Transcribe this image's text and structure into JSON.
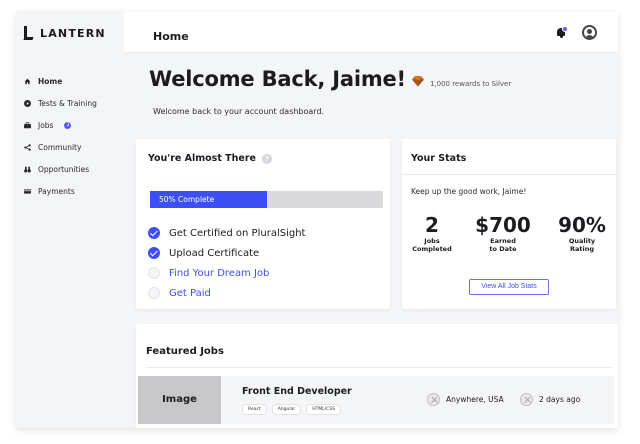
{
  "brand": {
    "name": "LANTERN"
  },
  "sidebar": {
    "items": [
      {
        "label": "Home",
        "icon": "home-icon",
        "active": true
      },
      {
        "label": "Tests & Training",
        "icon": "play-circle-icon"
      },
      {
        "label": "Jobs",
        "icon": "briefcase-icon",
        "badge": "3"
      },
      {
        "label": "Community",
        "icon": "share-icon"
      },
      {
        "label": "Opportunities",
        "icon": "binoculars-icon"
      },
      {
        "label": "Payments",
        "icon": "credit-card-icon"
      }
    ]
  },
  "header": {
    "title": "Home",
    "notification_dot_color": "#6b5cf6"
  },
  "welcome": {
    "title": "Welcome Back, Jaime!",
    "rewards": "1,000 rewards to Silver",
    "subtitle": "Welcome back to your account dashboard."
  },
  "almost": {
    "title": "You're Almost There",
    "progress_label": "50% Complete",
    "progress_value": 0.5,
    "tasks": [
      {
        "label": "Get Certified on PluralSight",
        "done": true
      },
      {
        "label": "Upload Certificate",
        "done": true
      },
      {
        "label": "Find Your Dream Job",
        "done": false
      },
      {
        "label": "Get Paid",
        "done": false
      }
    ]
  },
  "stats": {
    "title": "Your Stats",
    "subtitle": "Keep up the good work, Jaime!",
    "items": [
      {
        "value": "2",
        "label_line1": "Jobs",
        "label_line2": "Completed"
      },
      {
        "value": "$700",
        "label_line1": "Earned",
        "label_line2": "to Date"
      },
      {
        "value": "90%",
        "label_line1": "Quality",
        "label_line2": "Rating"
      }
    ],
    "button_label": "View All Job Stats"
  },
  "featured": {
    "title": "Featured Jobs",
    "jobs": [
      {
        "image_label": "Image",
        "title": "Front End Developer",
        "tags": [
          "React",
          "Angular",
          "HTML/CSS"
        ],
        "location": "Anywhere, USA",
        "posted": "2 days ago"
      }
    ]
  },
  "colors": {
    "accent": "#3d4ef5",
    "badge": "#5b59f0",
    "gem": "#c56a1f"
  }
}
